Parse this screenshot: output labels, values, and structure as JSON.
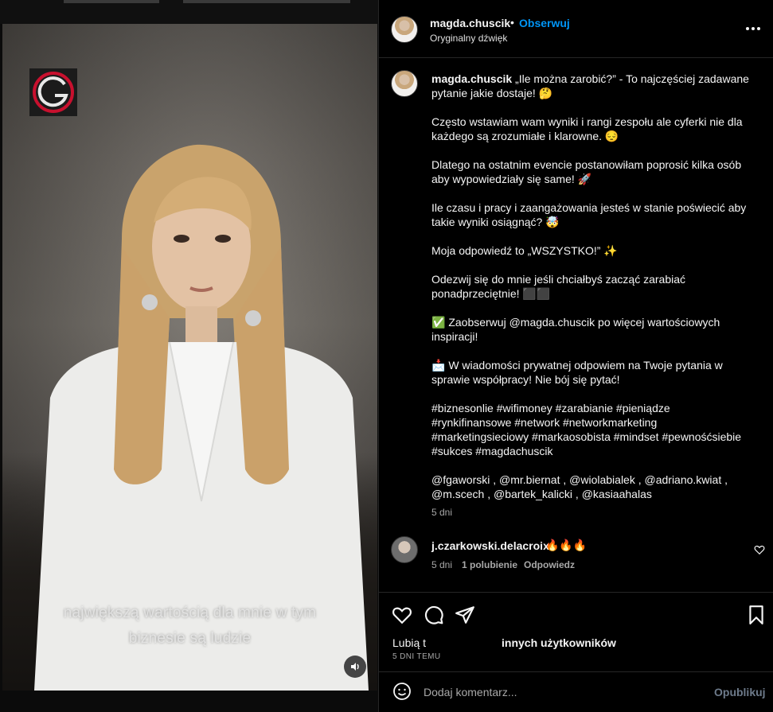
{
  "header": {
    "username": "magda.chuscik",
    "separator": "•",
    "follow_label": "Obserwuj",
    "audio_label": "Oryginalny dźwięk",
    "more_icon": "more-horizontal-icon"
  },
  "video": {
    "caption_line1": "największą wartością dla mnie w tym",
    "caption_line2": "biznesie są ludzie",
    "sound_icon": "speaker-icon"
  },
  "post": {
    "username": "magda.chuscik",
    "paragraphs": [
      "„Ile można zarobić?” - To najczęściej zadawane pytanie jakie dostaje! 🤔",
      "Często wstawiam wam wyniki i rangi zespołu ale cyferki nie dla każdego są zrozumiałe i klarowne. 😔",
      "Dlatego na ostatnim evencie postanowiłam poprosić kilka osób aby wypowiedziały się same! 🚀",
      "Ile czasu i pracy i zaangażowania jesteś w stanie poświecić aby takie wyniki osiągnąć? 🤯",
      "Moja odpowiedź to „WSZYSTKO!” ✨",
      "Odezwij się do mnie jeśli chciałbyś zacząć zarabiać ponadprzeciętnie! ⬛⬛",
      "✅ Zaobserwuj @magda.chuscik po więcej wartościowych inspiracji!",
      "📩 W wiadomości prywatnej odpowiem na Twoje pytania w sprawie współpracy! Nie bój się pytać!",
      "#biznesonlie #wifimoney #zarabianie #pieniądze #rynkifinansowe #network #networkmarketing #marketingsieciowy #markaosobista #mindset #pewnośćsiebie #sukces #magdachuscik",
      "@fgaworski , @mr.biernat , @wiolabialek , @adriano.kwiat , @m.scech , @bartek_kalicki , @kasiaahalas"
    ],
    "age": "5 dni"
  },
  "comment": {
    "username": "j.czarkowski.delacroix",
    "text": "🔥🔥🔥",
    "age": "5 dni",
    "likes": "1 polubienie",
    "reply_label": "Odpowiedz",
    "like_icon": "heart-icon"
  },
  "actions": {
    "icons": [
      "heart-icon",
      "comment-icon",
      "share-icon",
      "bookmark-icon"
    ],
    "likes_prefix": "Lubią t",
    "likes_suffix": "innych użytkowników",
    "date": "5 DNI TEMU"
  },
  "composer": {
    "placeholder": "Dodaj komentarz...",
    "publish_label": "Opublikuj",
    "emoji_icon": "emoji-icon"
  },
  "colors": {
    "accent": "#0095f6",
    "background": "#000000",
    "muted": "#a8a8a8"
  }
}
